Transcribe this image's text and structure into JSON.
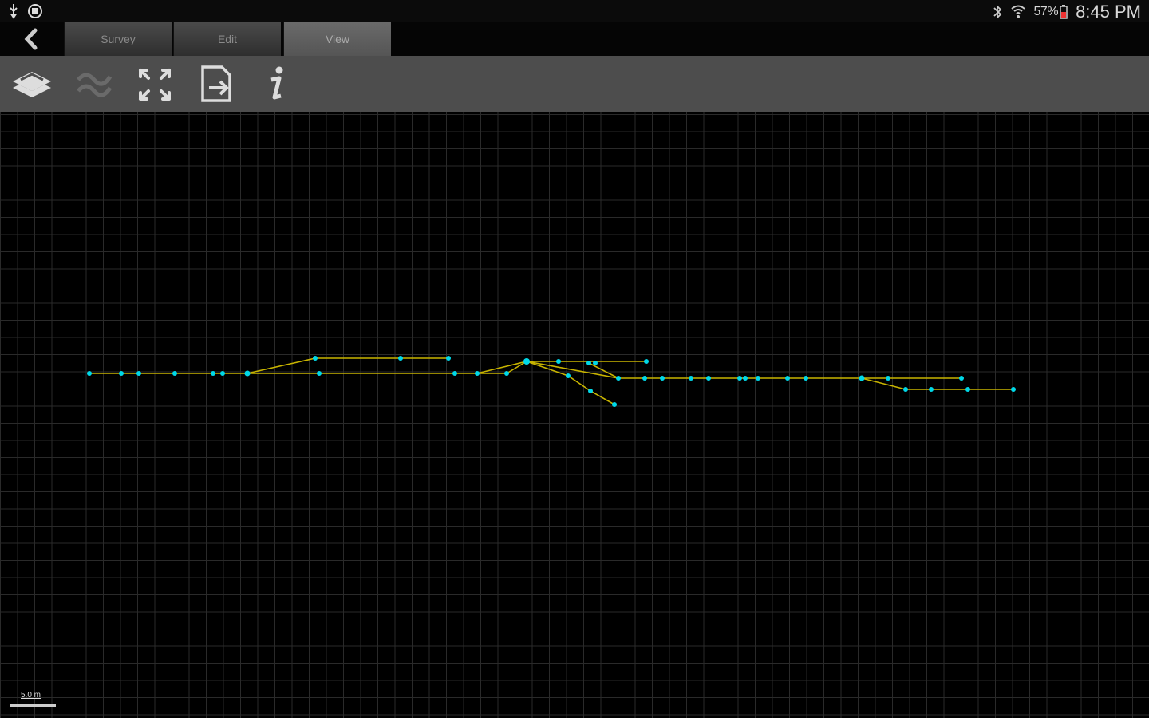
{
  "status_bar": {
    "icons_left": [
      "usb-icon",
      "notification-icon"
    ],
    "battery_percent": "57%",
    "time": "8:45 PM",
    "icons_right": [
      "bluetooth-icon",
      "wifi-icon",
      "battery-icon"
    ]
  },
  "tabs": [
    {
      "label": "Survey",
      "active": false
    },
    {
      "label": "Edit",
      "active": false
    },
    {
      "label": "View",
      "active": true
    }
  ],
  "toolbar": {
    "tools": [
      "layers-icon",
      "smooth-lines-icon",
      "fit-to-screen-icon",
      "export-icon",
      "info-icon"
    ]
  },
  "scale": {
    "label": "5.0 m"
  },
  "colors": {
    "line": "#c8b400",
    "station": "#00d8e8",
    "grid": "#2a2a2a",
    "toolbar": "#4d4d4d"
  }
}
